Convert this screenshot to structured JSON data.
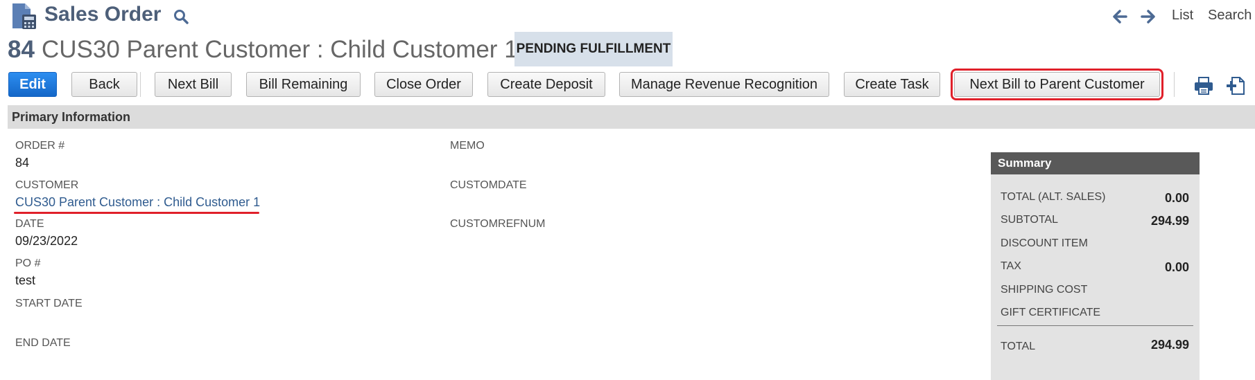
{
  "header": {
    "title": "Sales Order",
    "list_link": "List",
    "search_link": "Search"
  },
  "record": {
    "number": "84",
    "name": "CUS30 Parent Customer : Child Customer 1",
    "status": "PENDING FULFILLMENT"
  },
  "toolbar": {
    "edit": "Edit",
    "back": "Back",
    "next_bill": "Next Bill",
    "bill_remaining": "Bill Remaining",
    "close_order": "Close Order",
    "create_deposit": "Create Deposit",
    "manage_rev_rec": "Manage Revenue Recognition",
    "create_task": "Create Task",
    "next_bill_parent": "Next Bill to Parent Customer",
    "icons": [
      "print-icon",
      "new-document-icon"
    ]
  },
  "section": {
    "title": "Primary Information"
  },
  "fields": {
    "order_label": "ORDER #",
    "order_value": "84",
    "customer_label": "CUSTOMER",
    "customer_value": "CUS30 Parent Customer : Child Customer 1",
    "date_label": "DATE",
    "date_value": "09/23/2022",
    "po_label": "PO #",
    "po_value": "test",
    "start_date_label": "START DATE",
    "end_date_label": "END DATE",
    "memo_label": "MEMO",
    "customdate_label": "CUSTOMDATE",
    "customrefnum_label": "CUSTOMREFNUM"
  },
  "summary": {
    "title": "Summary",
    "rows": [
      {
        "label": "TOTAL (ALT. SALES)",
        "value": "0.00"
      },
      {
        "label": "SUBTOTAL",
        "value": "294.99"
      },
      {
        "label": "DISCOUNT ITEM",
        "value": ""
      },
      {
        "label": "TAX",
        "value": "0.00"
      },
      {
        "label": "SHIPPING COST",
        "value": ""
      },
      {
        "label": "GIFT CERTIFICATE",
        "value": ""
      }
    ],
    "total_label": "TOTAL",
    "total_value": "294.99"
  },
  "colors": {
    "title_blue": "#4d5f79",
    "edit_button": "#1467c8",
    "status_badge_bg": "#d7e0ea",
    "highlight_red": "#e0202a",
    "link_blue": "#2f5b8f",
    "summary_header": "#595959"
  }
}
